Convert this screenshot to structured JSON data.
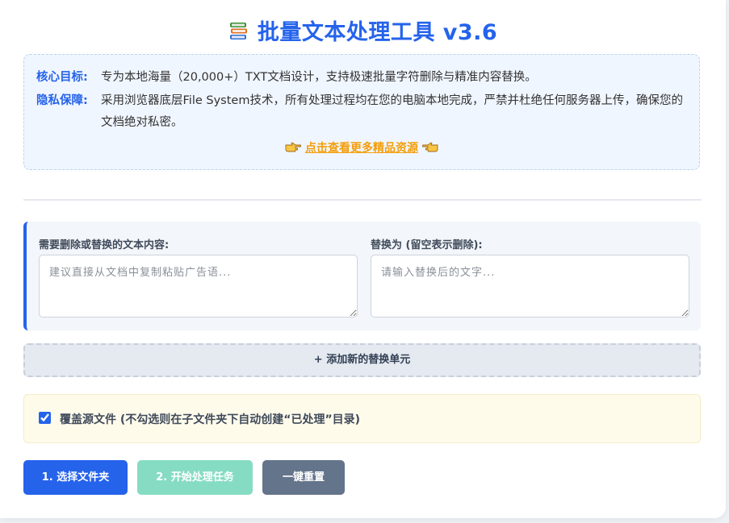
{
  "header": {
    "title": "批量文本处理工具 v3.6",
    "icon": "books-icon"
  },
  "info": {
    "goal_label": "核心目标:",
    "goal_text": "专为本地海量（20,000+）TXT文档设计，支持极速批量字符删除与精准内容替换。",
    "privacy_label": "隐私保障:",
    "privacy_text": "采用浏览器底层File System技术，所有处理过程均在您的电脑本地完成，严禁并杜绝任何服务器上传，确保您的文档绝对私密。",
    "more_link": "点击查看更多精品资源",
    "hand_icons": [
      "hand-pointing-right-icon",
      "hand-pointing-left-icon"
    ]
  },
  "replace_unit": {
    "find_label": "需要删除或替换的文本内容:",
    "find_placeholder": "建议直接从文档中复制粘贴广告语...",
    "find_value": "",
    "replace_label": "替换为 (留空表示删除):",
    "replace_placeholder": "请输入替换后的文字...",
    "replace_value": ""
  },
  "add_unit_label": "+ 添加新的替换单元",
  "overwrite": {
    "checked": true,
    "label": "覆盖源文件 (不勾选则在子文件夹下自动创建“已处理”目录)"
  },
  "buttons": {
    "select_folder": "1. 选择文件夹",
    "start_task": "2. 开始处理任务",
    "reset": "一键重置"
  },
  "colors": {
    "primary": "#2563eb",
    "link": "#f59e0b",
    "start_disabled": "#86dcc3",
    "reset": "#64748b",
    "info_bg": "#f0f6ff",
    "notice_bg": "#fffbeb"
  }
}
